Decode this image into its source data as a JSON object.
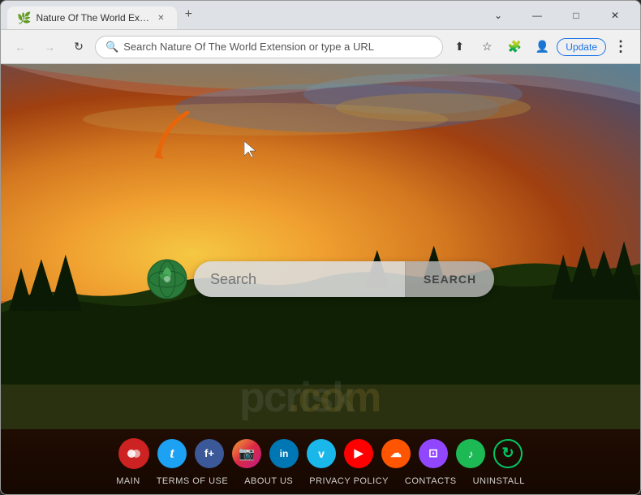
{
  "browser": {
    "tab": {
      "title": "Nature Of The World Extension",
      "favicon": "🌿"
    },
    "new_tab_label": "+",
    "address_bar": {
      "text": "Search Nature Of The World Extension or type a URL",
      "placeholder": "Search Nature Of The World Extension or type a URL"
    },
    "window_controls": {
      "minimize": "—",
      "maximize": "□",
      "close": "✕"
    },
    "nav_buttons": {
      "back": "←",
      "forward": "→",
      "refresh": "↻"
    },
    "update_button": "Update"
  },
  "page": {
    "search": {
      "placeholder": "Search",
      "button_label": "SEARCH"
    },
    "footer": {
      "links": [
        "MAIN",
        "TERMS OF USE",
        "ABOUT US",
        "PRIVACY POLICY",
        "CONTACTS",
        "UNINSTALL"
      ]
    },
    "social_icons": [
      {
        "name": "custom-red",
        "color": "#e53935",
        "label": "●●"
      },
      {
        "name": "twitter",
        "color": "#1da1f2",
        "label": "t"
      },
      {
        "name": "facebook-plus",
        "color": "#3b5998",
        "label": "f+"
      },
      {
        "name": "instagram",
        "color": "#c13584",
        "label": "📷"
      },
      {
        "name": "linkedin",
        "color": "#0077b5",
        "label": "in"
      },
      {
        "name": "vimeo",
        "color": "#1ab7ea",
        "label": "v"
      },
      {
        "name": "youtube",
        "color": "#ff0000",
        "label": "▶"
      },
      {
        "name": "soundcloud",
        "color": "#ff5500",
        "label": "☁"
      },
      {
        "name": "twitch",
        "color": "#9146ff",
        "label": "⊡"
      },
      {
        "name": "spotify",
        "color": "#1db954",
        "label": "♪"
      },
      {
        "name": "refresh-green",
        "color": "#00a86b",
        "label": "↻"
      }
    ]
  }
}
